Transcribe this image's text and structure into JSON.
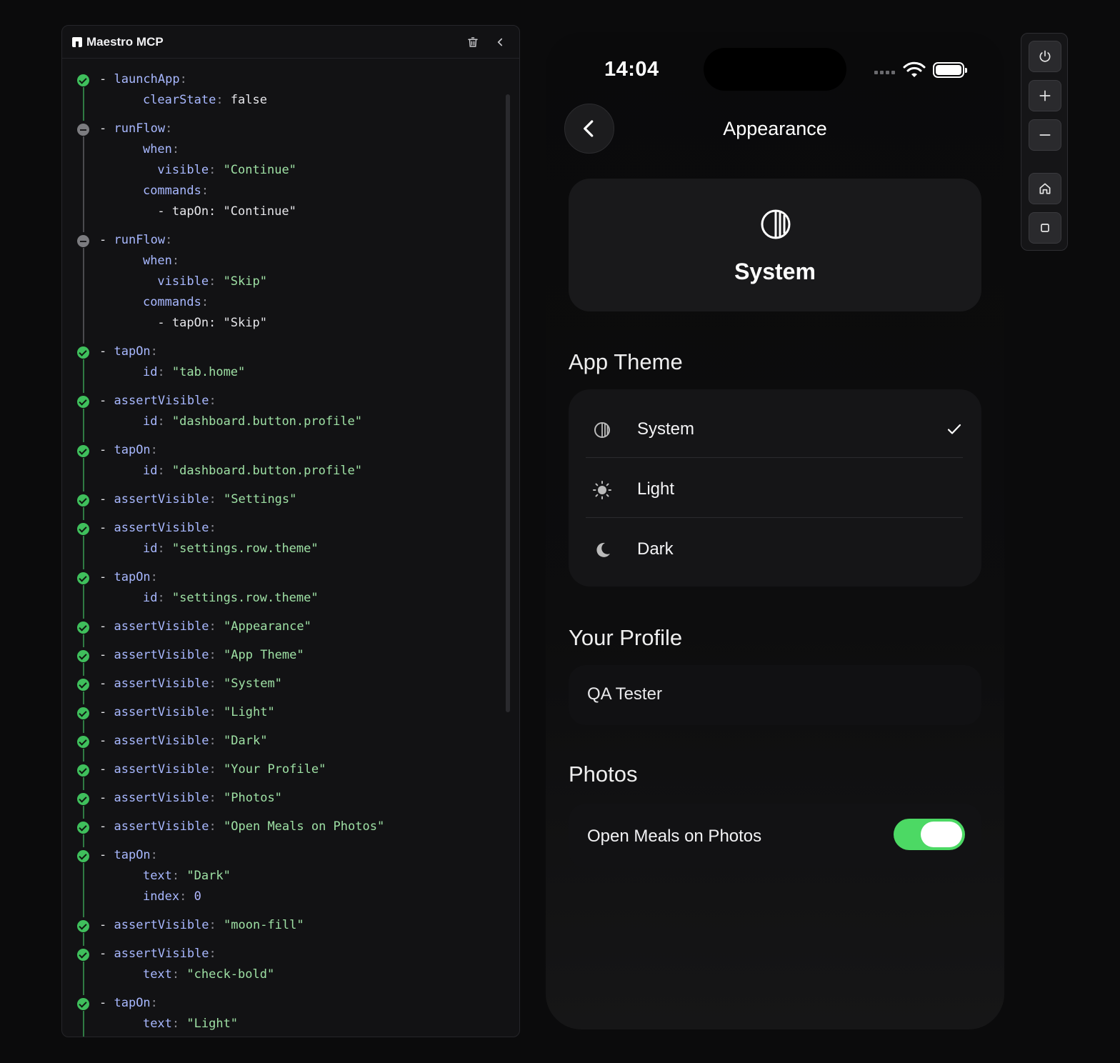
{
  "panel": {
    "title": "Maestro MCP",
    "icons": {
      "logo": "maestro-logo-icon",
      "trash": "trash-icon",
      "collapse": "chevron-left-icon"
    }
  },
  "steps": [
    {
      "status": "ok",
      "lines": [
        [
          {
            "t": "- ",
            "c": "v"
          },
          {
            "t": "launchApp",
            "c": "k"
          },
          {
            "t": ":",
            "c": "p"
          }
        ],
        [
          {
            "t": "    ",
            "c": "v"
          },
          {
            "t": "clearState",
            "c": "k"
          },
          {
            "t": ": ",
            "c": "p"
          },
          {
            "t": "false",
            "c": "v"
          }
        ]
      ]
    },
    {
      "status": "skip",
      "lines": [
        [
          {
            "t": "- ",
            "c": "v"
          },
          {
            "t": "runFlow",
            "c": "k"
          },
          {
            "t": ":",
            "c": "p"
          }
        ],
        [
          {
            "t": "    ",
            "c": "v"
          },
          {
            "t": "when",
            "c": "k"
          },
          {
            "t": ":",
            "c": "p"
          }
        ],
        [
          {
            "t": "      ",
            "c": "v"
          },
          {
            "t": "visible",
            "c": "k"
          },
          {
            "t": ": ",
            "c": "p"
          },
          {
            "t": "\"Continue\"",
            "c": "s"
          }
        ],
        [
          {
            "t": "    ",
            "c": "v"
          },
          {
            "t": "commands",
            "c": "k"
          },
          {
            "t": ":",
            "c": "p"
          }
        ],
        [
          {
            "t": "      - tapOn: \"Continue\"",
            "c": "v"
          }
        ]
      ]
    },
    {
      "status": "skip",
      "lines": [
        [
          {
            "t": "- ",
            "c": "v"
          },
          {
            "t": "runFlow",
            "c": "k"
          },
          {
            "t": ":",
            "c": "p"
          }
        ],
        [
          {
            "t": "    ",
            "c": "v"
          },
          {
            "t": "when",
            "c": "k"
          },
          {
            "t": ":",
            "c": "p"
          }
        ],
        [
          {
            "t": "      ",
            "c": "v"
          },
          {
            "t": "visible",
            "c": "k"
          },
          {
            "t": ": ",
            "c": "p"
          },
          {
            "t": "\"Skip\"",
            "c": "s"
          }
        ],
        [
          {
            "t": "    ",
            "c": "v"
          },
          {
            "t": "commands",
            "c": "k"
          },
          {
            "t": ":",
            "c": "p"
          }
        ],
        [
          {
            "t": "      - tapOn: \"Skip\"",
            "c": "v"
          }
        ]
      ]
    },
    {
      "status": "ok",
      "lines": [
        [
          {
            "t": "- ",
            "c": "v"
          },
          {
            "t": "tapOn",
            "c": "k"
          },
          {
            "t": ":",
            "c": "p"
          }
        ],
        [
          {
            "t": "    ",
            "c": "v"
          },
          {
            "t": "id",
            "c": "k"
          },
          {
            "t": ": ",
            "c": "p"
          },
          {
            "t": "\"tab.home\"",
            "c": "s"
          }
        ]
      ]
    },
    {
      "status": "ok",
      "lines": [
        [
          {
            "t": "- ",
            "c": "v"
          },
          {
            "t": "assertVisible",
            "c": "k"
          },
          {
            "t": ":",
            "c": "p"
          }
        ],
        [
          {
            "t": "    ",
            "c": "v"
          },
          {
            "t": "id",
            "c": "k"
          },
          {
            "t": ": ",
            "c": "p"
          },
          {
            "t": "\"dashboard.button.profile\"",
            "c": "s"
          }
        ]
      ]
    },
    {
      "status": "ok",
      "lines": [
        [
          {
            "t": "- ",
            "c": "v"
          },
          {
            "t": "tapOn",
            "c": "k"
          },
          {
            "t": ":",
            "c": "p"
          }
        ],
        [
          {
            "t": "    ",
            "c": "v"
          },
          {
            "t": "id",
            "c": "k"
          },
          {
            "t": ": ",
            "c": "p"
          },
          {
            "t": "\"dashboard.button.profile\"",
            "c": "s"
          }
        ]
      ]
    },
    {
      "status": "ok",
      "lines": [
        [
          {
            "t": "- ",
            "c": "v"
          },
          {
            "t": "assertVisible",
            "c": "k"
          },
          {
            "t": ": ",
            "c": "p"
          },
          {
            "t": "\"Settings\"",
            "c": "s"
          }
        ]
      ]
    },
    {
      "status": "ok",
      "lines": [
        [
          {
            "t": "- ",
            "c": "v"
          },
          {
            "t": "assertVisible",
            "c": "k"
          },
          {
            "t": ":",
            "c": "p"
          }
        ],
        [
          {
            "t": "    ",
            "c": "v"
          },
          {
            "t": "id",
            "c": "k"
          },
          {
            "t": ": ",
            "c": "p"
          },
          {
            "t": "\"settings.row.theme\"",
            "c": "s"
          }
        ]
      ]
    },
    {
      "status": "ok",
      "lines": [
        [
          {
            "t": "- ",
            "c": "v"
          },
          {
            "t": "tapOn",
            "c": "k"
          },
          {
            "t": ":",
            "c": "p"
          }
        ],
        [
          {
            "t": "    ",
            "c": "v"
          },
          {
            "t": "id",
            "c": "k"
          },
          {
            "t": ": ",
            "c": "p"
          },
          {
            "t": "\"settings.row.theme\"",
            "c": "s"
          }
        ]
      ]
    },
    {
      "status": "ok",
      "lines": [
        [
          {
            "t": "- ",
            "c": "v"
          },
          {
            "t": "assertVisible",
            "c": "k"
          },
          {
            "t": ": ",
            "c": "p"
          },
          {
            "t": "\"Appearance\"",
            "c": "s"
          }
        ]
      ]
    },
    {
      "status": "ok",
      "lines": [
        [
          {
            "t": "- ",
            "c": "v"
          },
          {
            "t": "assertVisible",
            "c": "k"
          },
          {
            "t": ": ",
            "c": "p"
          },
          {
            "t": "\"App Theme\"",
            "c": "s"
          }
        ]
      ]
    },
    {
      "status": "ok",
      "lines": [
        [
          {
            "t": "- ",
            "c": "v"
          },
          {
            "t": "assertVisible",
            "c": "k"
          },
          {
            "t": ": ",
            "c": "p"
          },
          {
            "t": "\"System\"",
            "c": "s"
          }
        ]
      ]
    },
    {
      "status": "ok",
      "lines": [
        [
          {
            "t": "- ",
            "c": "v"
          },
          {
            "t": "assertVisible",
            "c": "k"
          },
          {
            "t": ": ",
            "c": "p"
          },
          {
            "t": "\"Light\"",
            "c": "s"
          }
        ]
      ]
    },
    {
      "status": "ok",
      "lines": [
        [
          {
            "t": "- ",
            "c": "v"
          },
          {
            "t": "assertVisible",
            "c": "k"
          },
          {
            "t": ": ",
            "c": "p"
          },
          {
            "t": "\"Dark\"",
            "c": "s"
          }
        ]
      ]
    },
    {
      "status": "ok",
      "lines": [
        [
          {
            "t": "- ",
            "c": "v"
          },
          {
            "t": "assertVisible",
            "c": "k"
          },
          {
            "t": ": ",
            "c": "p"
          },
          {
            "t": "\"Your Profile\"",
            "c": "s"
          }
        ]
      ]
    },
    {
      "status": "ok",
      "lines": [
        [
          {
            "t": "- ",
            "c": "v"
          },
          {
            "t": "assertVisible",
            "c": "k"
          },
          {
            "t": ": ",
            "c": "p"
          },
          {
            "t": "\"Photos\"",
            "c": "s"
          }
        ]
      ]
    },
    {
      "status": "ok",
      "lines": [
        [
          {
            "t": "- ",
            "c": "v"
          },
          {
            "t": "assertVisible",
            "c": "k"
          },
          {
            "t": ": ",
            "c": "p"
          },
          {
            "t": "\"Open Meals on Photos\"",
            "c": "s"
          }
        ]
      ]
    },
    {
      "status": "ok",
      "lines": [
        [
          {
            "t": "- ",
            "c": "v"
          },
          {
            "t": "tapOn",
            "c": "k"
          },
          {
            "t": ":",
            "c": "p"
          }
        ],
        [
          {
            "t": "    ",
            "c": "v"
          },
          {
            "t": "text",
            "c": "k"
          },
          {
            "t": ": ",
            "c": "p"
          },
          {
            "t": "\"Dark\"",
            "c": "s"
          }
        ],
        [
          {
            "t": "    ",
            "c": "v"
          },
          {
            "t": "index",
            "c": "k"
          },
          {
            "t": ": ",
            "c": "p"
          },
          {
            "t": "0",
            "c": "n"
          }
        ]
      ]
    },
    {
      "status": "ok",
      "lines": [
        [
          {
            "t": "- ",
            "c": "v"
          },
          {
            "t": "assertVisible",
            "c": "k"
          },
          {
            "t": ": ",
            "c": "p"
          },
          {
            "t": "\"moon-fill\"",
            "c": "s"
          }
        ]
      ]
    },
    {
      "status": "ok",
      "lines": [
        [
          {
            "t": "- ",
            "c": "v"
          },
          {
            "t": "assertVisible",
            "c": "k"
          },
          {
            "t": ":",
            "c": "p"
          }
        ],
        [
          {
            "t": "    ",
            "c": "v"
          },
          {
            "t": "text",
            "c": "k"
          },
          {
            "t": ": ",
            "c": "p"
          },
          {
            "t": "\"check-bold\"",
            "c": "s"
          }
        ]
      ]
    },
    {
      "status": "ok",
      "lines": [
        [
          {
            "t": "- ",
            "c": "v"
          },
          {
            "t": "tapOn",
            "c": "k"
          },
          {
            "t": ":",
            "c": "p"
          }
        ],
        [
          {
            "t": "    ",
            "c": "v"
          },
          {
            "t": "text",
            "c": "k"
          },
          {
            "t": ": ",
            "c": "p"
          },
          {
            "t": "\"Light\"",
            "c": "s"
          }
        ]
      ]
    }
  ],
  "phone": {
    "status_bar": {
      "time": "14:04",
      "icons": [
        "signal-icon",
        "wifi-icon",
        "battery-icon"
      ]
    },
    "nav": {
      "title": "Appearance",
      "back_icon": "chevron-left-icon"
    },
    "hero": {
      "label": "System",
      "icon": "half-circle-icon"
    },
    "app_theme": {
      "title": "App Theme",
      "options": [
        {
          "label": "System",
          "icon": "half-circle-icon",
          "selected": true
        },
        {
          "label": "Light",
          "icon": "sun-icon",
          "selected": false
        },
        {
          "label": "Dark",
          "icon": "moon-icon",
          "selected": false
        }
      ],
      "check_icon": "check-icon"
    },
    "profile": {
      "title": "Your Profile",
      "name": "QA Tester"
    },
    "photos": {
      "title": "Photos",
      "toggle_label": "Open Meals on Photos",
      "toggle_on": true,
      "toggle_color": "#4cd964"
    }
  },
  "device_controls": [
    "power-icon",
    "plus-icon",
    "minus-icon",
    "home-icon",
    "square-icon"
  ]
}
